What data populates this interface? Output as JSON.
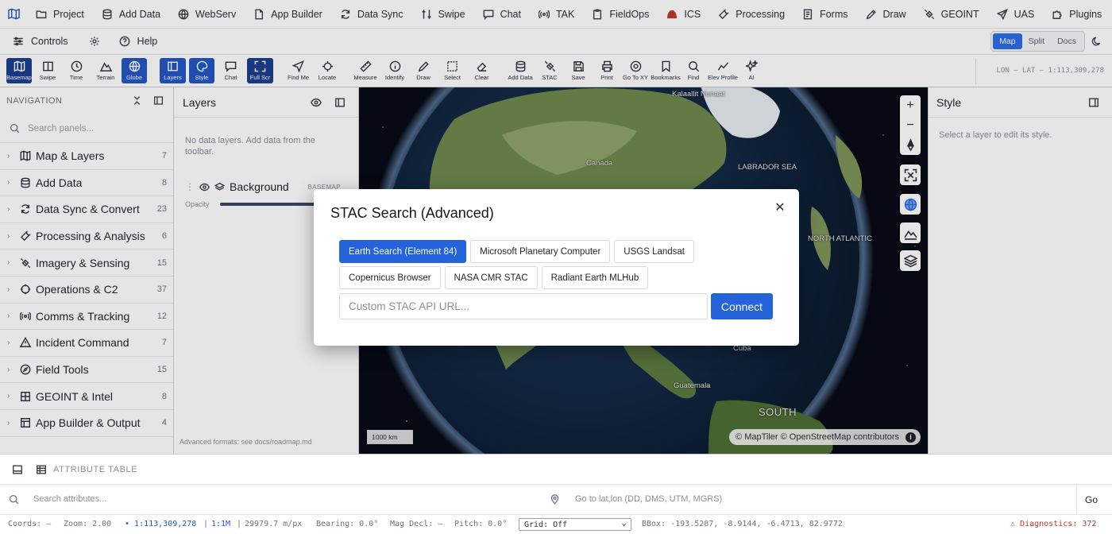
{
  "menubar": {
    "items": [
      "Project",
      "Add Data",
      "WebServ",
      "App Builder",
      "Data Sync",
      "Swipe",
      "Chat",
      "TAK",
      "FieldOps",
      "ICS",
      "Processing",
      "Forms",
      "Draw",
      "GEOINT",
      "UAS",
      "Plugins"
    ],
    "icons": [
      "folder-icon",
      "database-icon",
      "globe-icon",
      "document-icon",
      "sync-icon",
      "swipe-icon",
      "chat-icon",
      "radio-icon",
      "clipboard-icon",
      "ics-icon",
      "wrench-icon",
      "form-icon",
      "draw-icon",
      "satellite-icon",
      "plane-icon",
      "puzzle-icon"
    ]
  },
  "subbar": {
    "controls": "Controls",
    "help": "Help",
    "view_modes": [
      "Map",
      "Split",
      "Docs"
    ],
    "active_view": "Map"
  },
  "toolbar": {
    "tools": [
      "Basemap",
      "Swipe",
      "Time",
      "Terrain",
      "Globe",
      "Layers",
      "Style",
      "Chat",
      "Full Scr",
      "Find Me",
      "Locate",
      "Measure",
      "Identify",
      "Draw",
      "Select",
      "Clear",
      "Add Data",
      "STAC",
      "Save",
      "Print",
      "Go To XY",
      "Bookmarks",
      "Find",
      "Elev Profile",
      "AI"
    ],
    "readout": "LON —  LAT —  1:113,309,278"
  },
  "navigation": {
    "title": "NAVIGATION",
    "search_placeholder": "Search panels...",
    "items": [
      {
        "label": "Map & Layers",
        "count": "7"
      },
      {
        "label": "Add Data",
        "count": "8"
      },
      {
        "label": "Data Sync & Convert",
        "count": "23"
      },
      {
        "label": "Processing & Analysis",
        "count": "6"
      },
      {
        "label": "Imagery & Sensing",
        "count": "15"
      },
      {
        "label": "Operations & C2",
        "count": "37"
      },
      {
        "label": "Comms & Tracking",
        "count": "12"
      },
      {
        "label": "Incident Command",
        "count": "7"
      },
      {
        "label": "Field Tools",
        "count": "15"
      },
      {
        "label": "GEOINT & Intel",
        "count": "8"
      },
      {
        "label": "App Builder & Output",
        "count": "4"
      }
    ]
  },
  "layers": {
    "title": "Layers",
    "empty": "No data layers. Add data from the toolbar.",
    "background": "Background",
    "badge": "BASEMAP",
    "opacity_label": "Opacity",
    "opacity": 0.75,
    "advanced_note": "Advanced formats: see docs/roadmap.md"
  },
  "map": {
    "labels": {
      "kalaallit": "Kalaallit Nunaat",
      "canada": "Canada",
      "labrador": "LABRADOR SEA",
      "guatemala": "Guatemala",
      "south": "SOUTH",
      "cuba": "Cuba",
      "ocean": "NORTH ATLANTIC"
    },
    "scale_label": "1000 km",
    "attribution": "© MapTiler © OpenStreetMap contributors"
  },
  "style_panel": {
    "title": "Style",
    "hint": "Select a layer to edit its style."
  },
  "modal": {
    "title": "STAC Search (Advanced)",
    "providers_row1": [
      "Earth Search (Element 84)",
      "Microsoft Planetary Computer",
      "USGS Landsat"
    ],
    "providers_row2": [
      "Copernicus Browser",
      "NASA CMR STAC",
      "Radiant Earth MLHub"
    ],
    "active_provider": "Earth Search (Element 84)",
    "url_placeholder": "Custom STAC API URL...",
    "connect_label": "Connect"
  },
  "attribute_table": {
    "label": "ATTRIBUTE TABLE",
    "search_placeholder": "Search attributes...",
    "goto_placeholder": "Go to lat,lon (DD, DMS, UTM, MGRS)",
    "go_label": "Go"
  },
  "status": {
    "coords": "Coords: —",
    "zoom": "Zoom: 2.00",
    "scale": "1:113,309,278",
    "ratio": "1:1M",
    "mpx": "29979.7 m/px",
    "bearing": "Bearing: 0.0°",
    "mag": "Mag Decl: —",
    "pitch": "Pitch: 0.0°",
    "grid": "Grid: Off",
    "bbox": "BBox: -193.5287, -8.9144, -6.4713, 82.9772",
    "diagnostics": "Diagnostics: 372"
  },
  "colors": {
    "accent": "#2563db",
    "active_tool": "#2457c5",
    "diagnostics": "#c0392b"
  }
}
